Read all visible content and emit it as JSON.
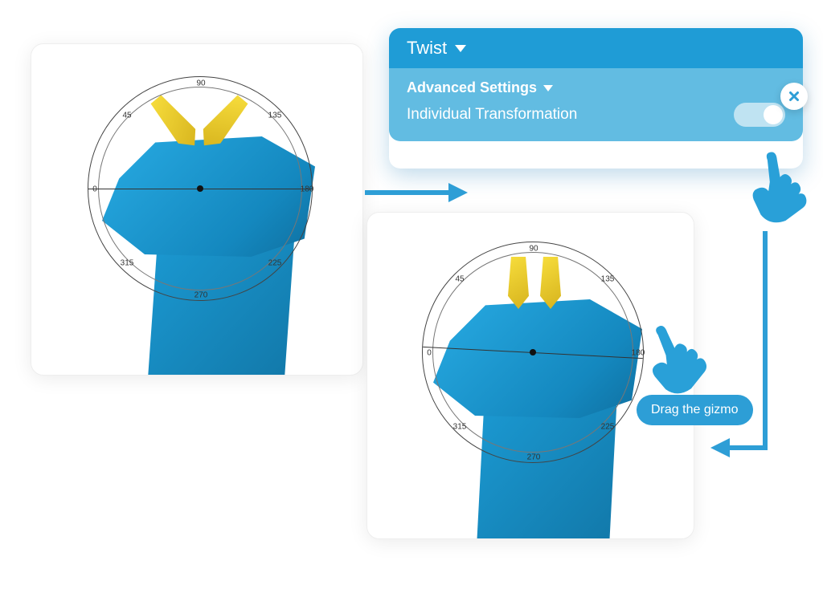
{
  "panel": {
    "title": "Twist",
    "section": "Advanced Settings",
    "row_label": "Individual Transformation",
    "toggle_on": true
  },
  "tooltip": {
    "drag": "Drag the gizmo"
  },
  "protractor": {
    "labels": [
      "0",
      "45",
      "90",
      "135",
      "180",
      "225",
      "270",
      "315"
    ]
  },
  "colors": {
    "primary": "#1f9cd6",
    "primary_light": "#62bce2",
    "accent_yellow": "#f3d22a",
    "model_blue": "#199ed8"
  }
}
